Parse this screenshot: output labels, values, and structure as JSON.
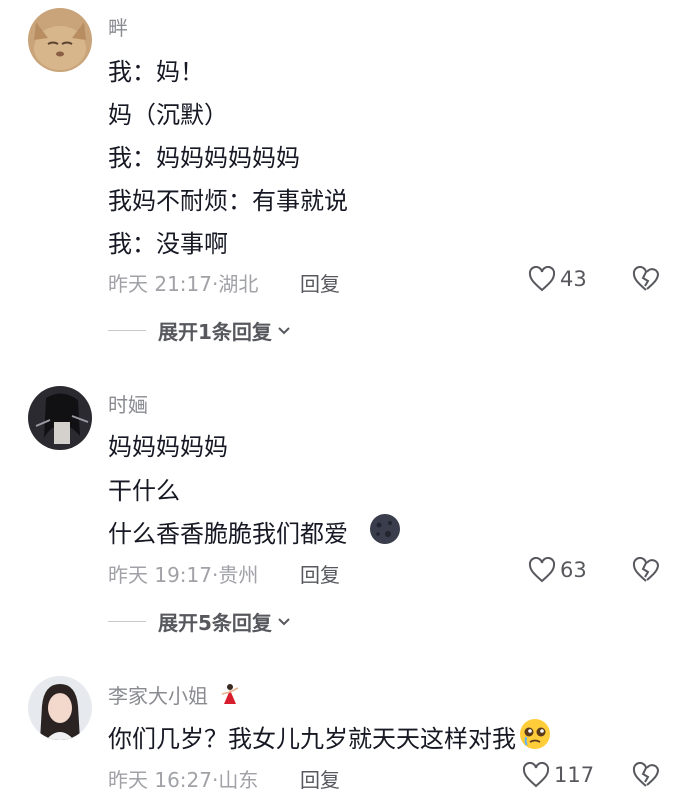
{
  "comments": [
    {
      "username": "畔",
      "lines": [
        "我：妈！",
        "妈（沉默）",
        "我：妈妈妈妈妈妈",
        "我妈不耐烦：有事就说",
        "我：没事啊"
      ],
      "time": "昨天 21:17",
      "location": "湖北",
      "reply_label": "回复",
      "likes": "43",
      "expand_label": "展开1条回复"
    },
    {
      "username": "时婳",
      "lines": [
        "妈妈妈妈妈",
        "干什么",
        "什么香香脆脆我们都爱"
      ],
      "time": "昨天 19:17",
      "location": "贵州",
      "reply_label": "回复",
      "likes": "63",
      "expand_label": "展开5条回复"
    },
    {
      "username": "李家大小姐",
      "lines": [
        "你们几岁？我女儿九岁就天天这样对我"
      ],
      "time": "昨天 16:27",
      "location": "山东",
      "reply_label": "回复",
      "likes": "117"
    }
  ],
  "icons": {
    "like": "heart-outline-icon",
    "dislike": "broken-heart-icon",
    "expand": "chevron-down-icon"
  },
  "colors": {
    "text": "#161823",
    "meta": "#a1a2a7",
    "username": "#8a8b91",
    "action": "#57585e"
  }
}
